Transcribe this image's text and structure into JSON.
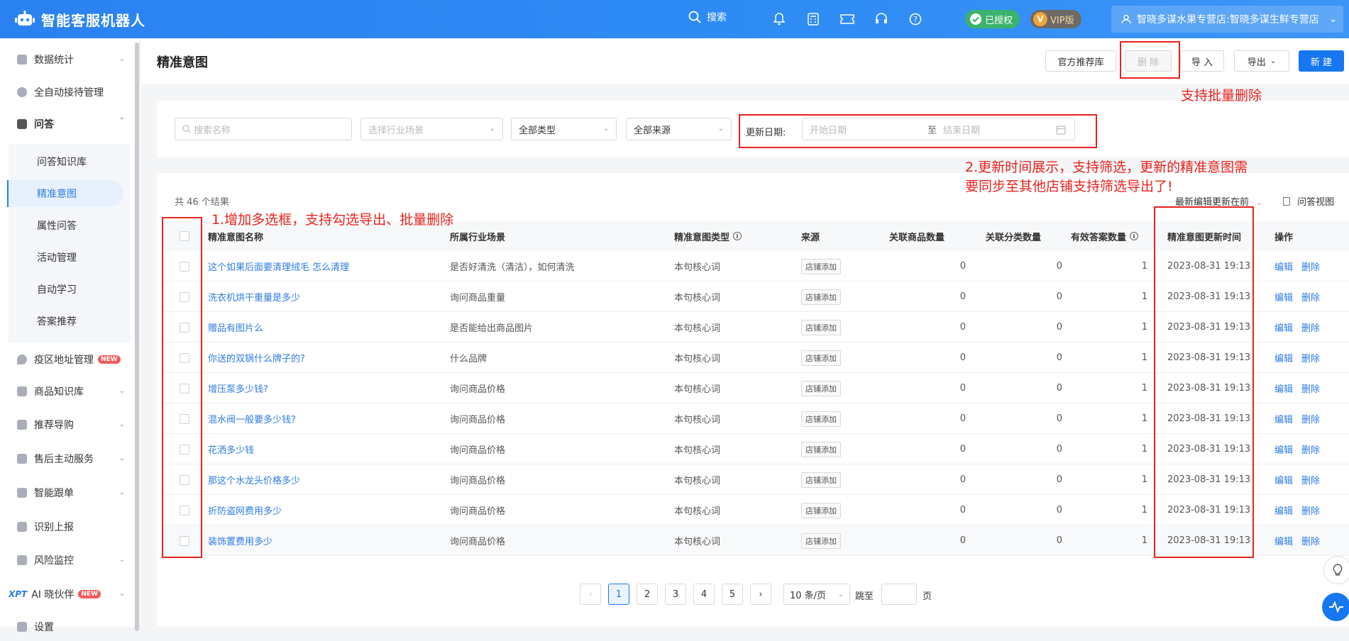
{
  "app": {
    "title": "智能客服机器人"
  },
  "topbar": {
    "search_label": "搜索",
    "auth_badge": "已授权",
    "vip_badge": "VIP版",
    "store_name": "智晓多谋水果专营店:智晓多谋生鲜专营店"
  },
  "sidebar": {
    "items": [
      {
        "label": "数据统计"
      },
      {
        "label": "全自动接待管理"
      },
      {
        "label": "问答"
      },
      {
        "label": "疫区地址管理",
        "tag": "NEW"
      },
      {
        "label": "商品知识库"
      },
      {
        "label": "推荐导购"
      },
      {
        "label": "售后主动服务"
      },
      {
        "label": "智能跟单"
      },
      {
        "label": "识别上报"
      },
      {
        "label": "风险监控"
      },
      {
        "label": "AI 晓伙伴",
        "prefix": "XPT",
        "tag": "NEW"
      },
      {
        "label": "设置"
      }
    ],
    "sub_items": [
      {
        "label": "问答知识库"
      },
      {
        "label": "精准意图"
      },
      {
        "label": "属性问答"
      },
      {
        "label": "活动管理"
      },
      {
        "label": "自动学习"
      },
      {
        "label": "答案推荐"
      }
    ]
  },
  "page": {
    "title": "精准意图",
    "buttons": {
      "official_lib": "官方推荐库",
      "delete": "删 除",
      "import": "导 入",
      "export": "导出",
      "new": "新 建"
    }
  },
  "filters": {
    "search_placeholder": "搜索名称",
    "industry_placeholder": "选择行业场景",
    "type_value": "全部类型",
    "source_value": "全部来源",
    "date_label": "更新日期:",
    "start_placeholder": "开始日期",
    "to": "至",
    "end_placeholder": "结束日期"
  },
  "table": {
    "total_text": "共 46 个结果",
    "sort_value": "最新编辑更新在前",
    "view_link": "问答视图",
    "headers": {
      "name": "精准意图名称",
      "scene": "所属行业场景",
      "type": "精准意图类型",
      "source": "来源",
      "goods": "关联商品数量",
      "category": "关联分类数量",
      "answers": "有效答案数量",
      "updated": "精准意图更新时间",
      "ops": "操作"
    },
    "rows": [
      {
        "name": "这个如果后面要清理绒毛 怎么清理",
        "scene": "是否好清洗（清洁），如何清洗",
        "type": "本句核心词",
        "source": "店铺添加",
        "goods": "0",
        "category": "0",
        "answers": "1",
        "updated": "2023-08-31 19:13",
        "edit": "编辑",
        "del": "删除"
      },
      {
        "name": "洗衣机烘干重量是多少",
        "scene": "询问商品重量",
        "type": "本句核心词",
        "source": "店铺添加",
        "goods": "0",
        "category": "0",
        "answers": "1",
        "updated": "2023-08-31 19:13",
        "edit": "编辑",
        "del": "删除"
      },
      {
        "name": "赠品有图片么",
        "scene": "是否能给出商品图片",
        "type": "本句核心词",
        "source": "店铺添加",
        "goods": "0",
        "category": "0",
        "answers": "1",
        "updated": "2023-08-31 19:13",
        "edit": "编辑",
        "del": "删除"
      },
      {
        "name": "你送的双锅什么牌子的?",
        "scene": "什么品牌",
        "type": "本句核心词",
        "source": "店铺添加",
        "goods": "0",
        "category": "0",
        "answers": "1",
        "updated": "2023-08-31 19:13",
        "edit": "编辑",
        "del": "删除"
      },
      {
        "name": "增压泵多少钱?",
        "scene": "询问商品价格",
        "type": "本句核心词",
        "source": "店铺添加",
        "goods": "0",
        "category": "0",
        "answers": "1",
        "updated": "2023-08-31 19:13",
        "edit": "编辑",
        "del": "删除"
      },
      {
        "name": "混水阀一般要多少钱?",
        "scene": "询问商品价格",
        "type": "本句核心词",
        "source": "店铺添加",
        "goods": "0",
        "category": "0",
        "answers": "1",
        "updated": "2023-08-31 19:13",
        "edit": "编辑",
        "del": "删除"
      },
      {
        "name": "花洒多少钱",
        "scene": "询问商品价格",
        "type": "本句核心词",
        "source": "店铺添加",
        "goods": "0",
        "category": "0",
        "answers": "1",
        "updated": "2023-08-31 19:13",
        "edit": "编辑",
        "del": "删除"
      },
      {
        "name": "那这个水龙头价格多少",
        "scene": "询问商品价格",
        "type": "本句核心词",
        "source": "店铺添加",
        "goods": "0",
        "category": "0",
        "answers": "1",
        "updated": "2023-08-31 19:13",
        "edit": "编辑",
        "del": "删除"
      },
      {
        "name": "折防盗网费用多少",
        "scene": "询问商品价格",
        "type": "本句核心词",
        "source": "店铺添加",
        "goods": "0",
        "category": "0",
        "answers": "1",
        "updated": "2023-08-31 19:13",
        "edit": "编辑",
        "del": "删除"
      },
      {
        "name": "装饰置费用多少",
        "scene": "询问商品价格",
        "type": "本句核心词",
        "source": "店铺添加",
        "goods": "0",
        "category": "0",
        "answers": "1",
        "updated": "2023-08-31 19:13",
        "edit": "编辑",
        "del": "删除"
      }
    ]
  },
  "pagination": {
    "pages": [
      "1",
      "2",
      "3",
      "4",
      "5"
    ],
    "current": "1",
    "page_size": "10 条/页",
    "jump_label": "跳至",
    "page_suffix": "页"
  },
  "annotations": {
    "batch_delete": "支持批量删除",
    "date_note_line1": "2.更新时间展示，支持筛选，更新的精准意图需",
    "date_note_line2": "要同步至其他店铺支持筛选导出了!",
    "checkbox_note": "1.增加多选框，支持勾选导出、批量删除"
  },
  "colors": {
    "topbar": "#2f8cf5",
    "primary": "#1677f0",
    "link": "#2d7be6",
    "annotation": "#e8231d"
  }
}
